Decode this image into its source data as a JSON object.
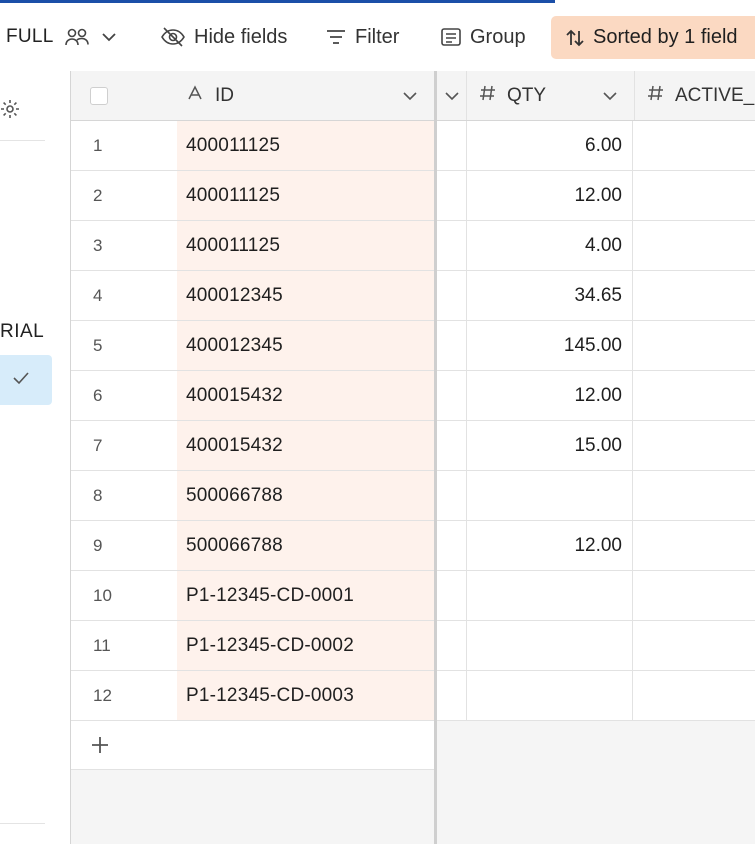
{
  "toolbar": {
    "view_name": "FULL",
    "hide_fields_label": "Hide fields",
    "filter_label": "Filter",
    "group_label": "Group",
    "sort_label": "Sorted by 1 field"
  },
  "sidebar": {
    "section_label_partial": "RIAL"
  },
  "columns": {
    "id_header": "ID",
    "qty_header": "QTY",
    "active_header_partial": "ACTIVE_C"
  },
  "rows": [
    {
      "n": "1",
      "id": "400011125",
      "qty": "6.00"
    },
    {
      "n": "2",
      "id": "400011125",
      "qty": "12.00"
    },
    {
      "n": "3",
      "id": "400011125",
      "qty": "4.00"
    },
    {
      "n": "4",
      "id": "400012345",
      "qty": "34.65"
    },
    {
      "n": "5",
      "id": "400012345",
      "qty": "145.00"
    },
    {
      "n": "6",
      "id": "400015432",
      "qty": "12.00"
    },
    {
      "n": "7",
      "id": "400015432",
      "qty": "15.00"
    },
    {
      "n": "8",
      "id": "500066788",
      "qty": ""
    },
    {
      "n": "9",
      "id": "500066788",
      "qty": "12.00"
    },
    {
      "n": "10",
      "id": "P1-12345-CD-0001",
      "qty": ""
    },
    {
      "n": "11",
      "id": "P1-12345-CD-0002",
      "qty": ""
    },
    {
      "n": "12",
      "id": "P1-12345-CD-0003",
      "qty": ""
    }
  ],
  "icons": {
    "people": "people-icon",
    "chevron": "chevron-down-icon",
    "hide": "eye-off-icon",
    "filter": "filter-icon",
    "group": "group-icon",
    "sort": "sort-icon",
    "gear": "gear-icon",
    "check": "check-icon",
    "text_field": "text-field-icon",
    "number_field": "number-field-icon",
    "plus": "plus-icon"
  },
  "colors": {
    "accent_blue": "#1b4fa8",
    "sort_button_bg": "#fbd9c2",
    "id_column_bg": "#fef2ec",
    "selected_sidebar_bg": "#d7ecfa"
  }
}
